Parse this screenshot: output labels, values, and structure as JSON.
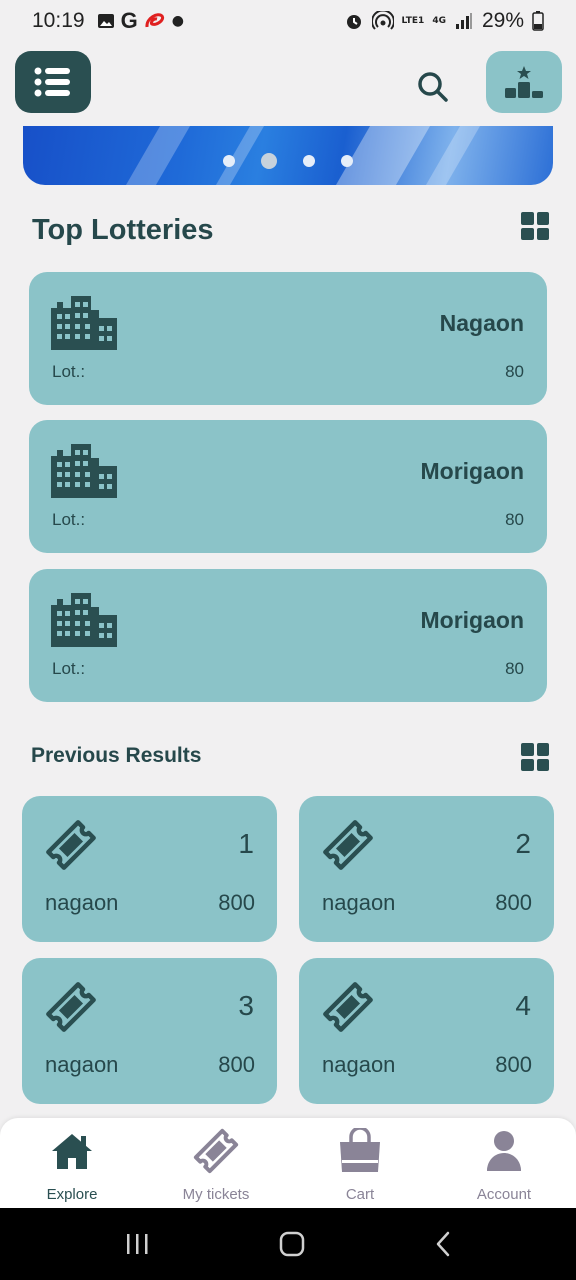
{
  "status_bar": {
    "time": "10:19",
    "network": "LTE1",
    "signal": "4G",
    "battery": "29%"
  },
  "header": {
    "menu_icon": "menu-icon",
    "search_icon": "search-icon",
    "leaderboard_icon": "leaderboard-icon"
  },
  "banner": {
    "slides": 4,
    "active_slide": 2
  },
  "top_lotteries": {
    "title": "Top Lotteries",
    "items": [
      {
        "name": "Nagaon",
        "lot_label": "Lot.:",
        "lot_value": "80"
      },
      {
        "name": "Morigaon",
        "lot_label": "Lot.:",
        "lot_value": "80"
      },
      {
        "name": "Morigaon",
        "lot_label": "Lot.:",
        "lot_value": "80"
      }
    ]
  },
  "previous_results": {
    "title": "Previous Results",
    "items": [
      {
        "number": "1",
        "name": "nagaon",
        "value": "800"
      },
      {
        "number": "2",
        "name": "nagaon",
        "value": "800"
      },
      {
        "number": "3",
        "name": "nagaon",
        "value": "800"
      },
      {
        "number": "4",
        "name": "nagaon",
        "value": "800"
      }
    ]
  },
  "bottom_nav": {
    "items": [
      {
        "label": "Explore",
        "icon": "home-icon",
        "active": true
      },
      {
        "label": "My tickets",
        "icon": "ticket-icon",
        "active": false
      },
      {
        "label": "Cart",
        "icon": "bag-icon",
        "active": false
      },
      {
        "label": "Account",
        "icon": "user-icon",
        "active": false
      }
    ]
  },
  "colors": {
    "primary": "#2a4f51",
    "card": "#8bc3c8",
    "background": "#f1f0f1",
    "inactive": "#8a8497"
  }
}
